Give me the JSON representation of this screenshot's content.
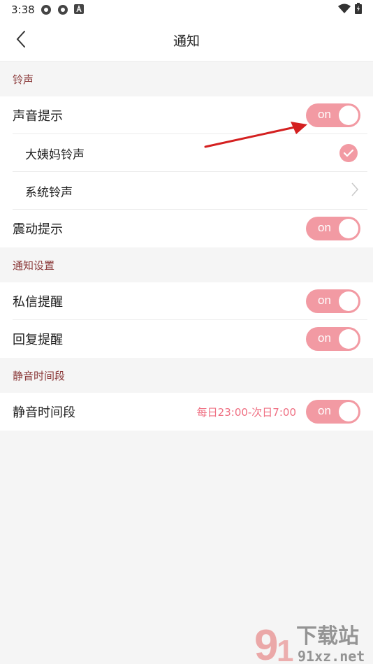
{
  "status_bar": {
    "time": "3:38"
  },
  "header": {
    "title": "通知"
  },
  "sections": {
    "ringtone": {
      "title": "铃声",
      "sound_alert": {
        "label": "声音提示",
        "toggle_text": "on"
      },
      "option_dayima": {
        "label": "大姨妈铃声",
        "selected": true
      },
      "option_system": {
        "label": "系统铃声"
      },
      "vibrate": {
        "label": "震动提示",
        "toggle_text": "on"
      }
    },
    "notification": {
      "title": "通知设置",
      "private_msg": {
        "label": "私信提醒",
        "toggle_text": "on"
      },
      "reply": {
        "label": "回复提醒",
        "toggle_text": "on"
      }
    },
    "quiet": {
      "title": "静音时间段",
      "quiet_hours": {
        "label": "静音时间段",
        "range": "每日23:00-次日7:00",
        "toggle_text": "on"
      }
    }
  },
  "watermark": {
    "text_top": "下载站",
    "text_bottom": "91xz.net"
  },
  "colors": {
    "accent": "#f29aa3",
    "section_title": "#8b3a3a",
    "time_text": "#ef6f82",
    "arrow": "#d42020"
  }
}
